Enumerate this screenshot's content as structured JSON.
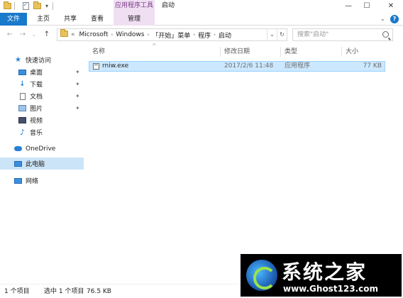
{
  "title_bar": {
    "contextual_group": "应用程序工具",
    "window_title": "启动",
    "buttons": {
      "minimize": "—",
      "maximize": "☐",
      "close": "✕"
    }
  },
  "ribbon": {
    "tabs": [
      "文件",
      "主页",
      "共享",
      "查看",
      "管理"
    ],
    "expand_icon": "chevron-down",
    "help_icon": "?"
  },
  "address_bar": {
    "prefix": "«",
    "breadcrumbs": [
      "Microsoft",
      "Windows",
      "「开始」菜单",
      "程序",
      "启动"
    ],
    "search_placeholder": "搜索\"启动\""
  },
  "nav_pane": {
    "quick_access": "快速访问",
    "quick_items": [
      "桌面",
      "下载",
      "文档",
      "图片",
      "视频",
      "音乐"
    ],
    "onedrive": "OneDrive",
    "this_pc": "此电脑",
    "network": "网络"
  },
  "columns": {
    "name": "名称",
    "date": "修改日期",
    "type": "类型",
    "size": "大小"
  },
  "files": [
    {
      "name": "rniw.exe",
      "date": "2017/2/6 11:48",
      "type": "应用程序",
      "size": "77 KB"
    }
  ],
  "status_bar": {
    "count": "1 个项目",
    "selected": "选中 1 个项目",
    "size": "76.5 KB"
  },
  "watermark": {
    "title": "系统之家",
    "url": "www.Ghost123.com"
  },
  "colors": {
    "accent": "#1979ca",
    "selection": "#cce8ff",
    "context_tab": "#f0dff3"
  }
}
